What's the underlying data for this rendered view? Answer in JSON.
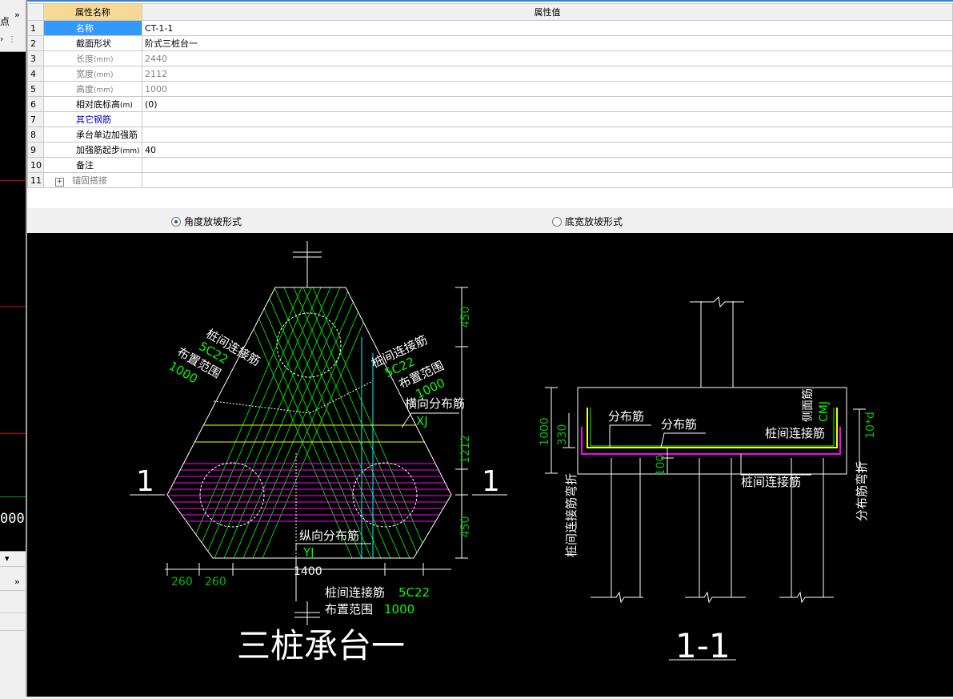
{
  "left_panel": {
    "top_label": "点",
    "chevron": "»",
    "chevron_small": "›",
    "value_text": "000",
    "panel_chevron": "»"
  },
  "table": {
    "header_name": "属性名称",
    "header_value": "属性值",
    "rows": [
      {
        "num": "1",
        "name": "名称",
        "value": "CT-1-1"
      },
      {
        "num": "2",
        "name": "截面形状",
        "value": "阶式三桩台一"
      },
      {
        "num": "3",
        "name": "长度",
        "unit": "(mm)",
        "value": "2440"
      },
      {
        "num": "4",
        "name": "宽度",
        "unit": "(mm)",
        "value": "2112"
      },
      {
        "num": "5",
        "name": "高度",
        "unit": "(mm)",
        "value": "1000"
      },
      {
        "num": "6",
        "name": "相对底标高",
        "unit": "(m)",
        "value": "(0)"
      },
      {
        "num": "7",
        "name": "其它钢筋",
        "value": ""
      },
      {
        "num": "8",
        "name": "承台单边加强筋",
        "value": ""
      },
      {
        "num": "9",
        "name": "加强筋起步",
        "unit": "(mm)",
        "value": "40"
      },
      {
        "num": "10",
        "name": "备注",
        "value": ""
      },
      {
        "num": "11",
        "name": "锚固搭接",
        "value": ""
      }
    ],
    "expand_symbol": "+"
  },
  "radios": {
    "option1": "角度放坡形式",
    "option2": "底宽放坡形式",
    "selected": "option1"
  },
  "drawing": {
    "plan": {
      "title": "三桩承台一",
      "section_mark": "1",
      "left_rebar_label": "桩间连接筋",
      "left_rebar_spec": "5C22",
      "left_range_label": "布置范围",
      "left_range_value": "1000",
      "right_rebar_label": "桩间连接筋",
      "right_rebar_spec": "5C22",
      "right_range_label": "布置范围",
      "right_range_value": "1000",
      "transverse_label": "横向分布筋",
      "transverse_code": "XJ",
      "longitudinal_label": "纵向分布筋",
      "longitudinal_code": "YJ",
      "bottom_rebar_label": "桩间连接筋",
      "bottom_rebar_spec": "5C22",
      "bottom_range_label": "布置范围",
      "bottom_range_value": "1000",
      "dim_top": "450",
      "dim_mid": "1212",
      "dim_bottom": "450",
      "dim_width": "1400",
      "dim_left1": "260",
      "dim_left2": "260"
    },
    "section": {
      "title": "1-1",
      "label_dist1": "分布筋",
      "label_dist2": "分布筋",
      "label_side": "侧面筋",
      "label_cmj": "CMJ",
      "label_conn": "桩间连接筋",
      "label_conn_bottom": "桩间连接筋",
      "label_bend_left": "桩间连接筋弯折",
      "label_bend_right": "分布筋弯折",
      "dim_height": "1000",
      "dim_330": "330",
      "dim_100": "100",
      "dim_10d": "10*d"
    },
    "colors": {
      "background": "#000000",
      "outline": "#ffffff",
      "rebar_green": "#00ff00",
      "rebar_yellow": "#ffff00",
      "rebar_magenta": "#ff00ff",
      "dim_green": "#00c000",
      "cyan": "#00ffff"
    }
  }
}
